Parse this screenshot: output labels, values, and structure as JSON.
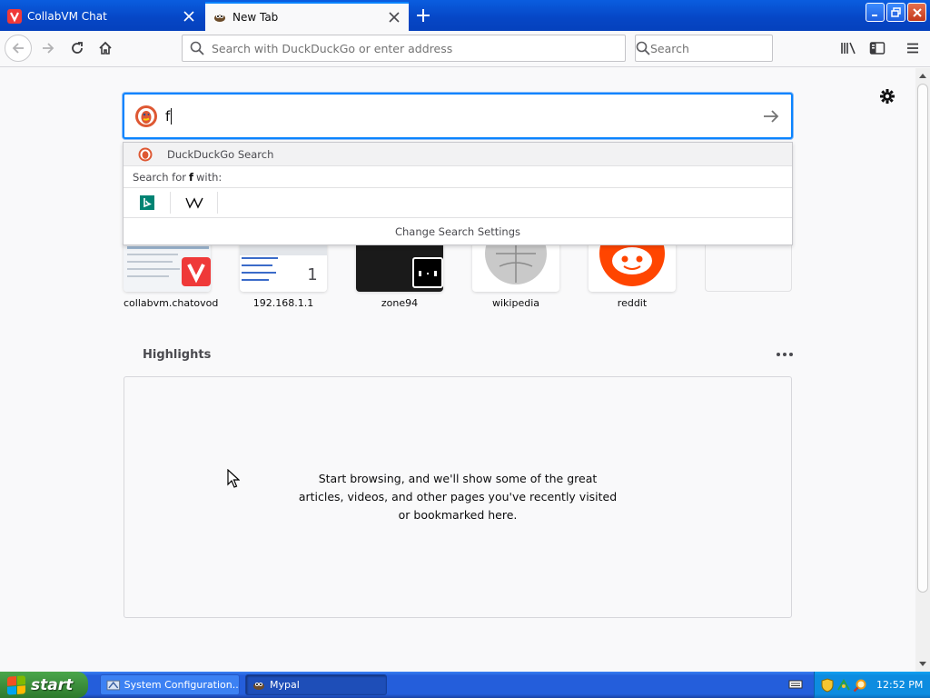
{
  "window": {
    "tabs": [
      {
        "title": "CollabVM Chat",
        "active": false
      },
      {
        "title": "New Tab",
        "active": true
      }
    ]
  },
  "navbar": {
    "url_placeholder": "Search with DuckDuckGo or enter address",
    "search_placeholder": "Search"
  },
  "search": {
    "value": "f",
    "engine_label": "DuckDuckGo Search",
    "search_for_prefix": "Search for",
    "search_for_term": "f",
    "search_for_suffix": "with:",
    "engines": [
      "bing",
      "wikipedia"
    ],
    "settings_link": "Change Search Settings"
  },
  "topsites": [
    {
      "label": "collabvm.chatovod"
    },
    {
      "label": "192.168.1.1"
    },
    {
      "label": "zone94"
    },
    {
      "label": "wikipedia"
    },
    {
      "label": "reddit"
    },
    {
      "label": ""
    }
  ],
  "topsite_badge": "1",
  "highlights": {
    "title": "Highlights",
    "empty_text": "Start browsing, and we'll show some of the great articles, videos, and other pages you've recently visited or bookmarked here."
  },
  "taskbar": {
    "start_label": "start",
    "tasks": [
      {
        "label": "System Configuration...",
        "active": false
      },
      {
        "label": "Mypal",
        "active": true
      }
    ],
    "clock": "12:52 PM"
  },
  "colors": {
    "accent": "#0a84ff",
    "titlebar": "#0646c5",
    "taskbar": "#245edb",
    "start_green": "#3c8f3c",
    "reddit": "#ff4500"
  }
}
